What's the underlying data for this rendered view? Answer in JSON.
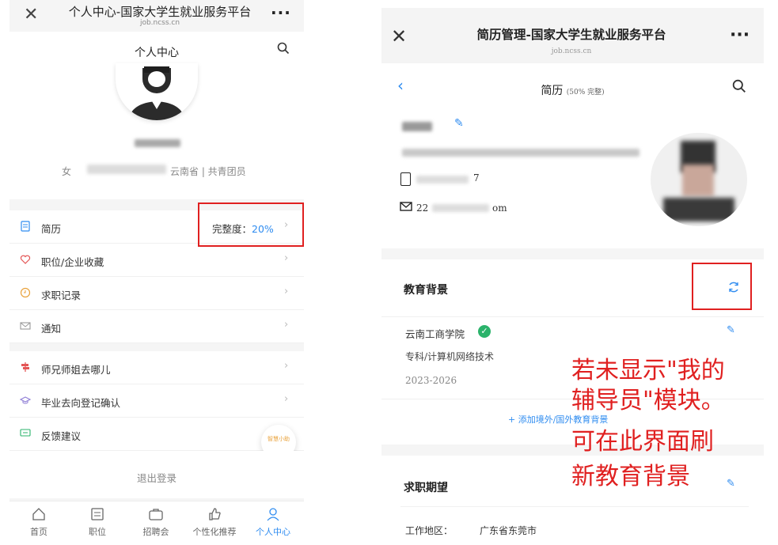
{
  "left": {
    "window": {
      "title": "个人中心-国家大学生就业服务平台",
      "domain": "job.ncss.cn"
    },
    "nav": {
      "title": "个人中心"
    },
    "profile": {
      "gender": "女",
      "region_party": "云南省 | 共青团员"
    },
    "menu_group1": [
      {
        "label": "简历",
        "value_label": "完整度：",
        "value": "20%"
      },
      {
        "label": "职位/企业收藏"
      },
      {
        "label": "求职记录"
      },
      {
        "label": "通知"
      }
    ],
    "menu_group2": [
      {
        "label": "师兄师姐去哪儿"
      },
      {
        "label": "毕业去向登记确认"
      },
      {
        "label": "反馈建议"
      }
    ],
    "assistant": {
      "label": "智慧小助"
    },
    "logout": "退出登录",
    "tabs": [
      {
        "label": "首页"
      },
      {
        "label": "职位"
      },
      {
        "label": "招聘会"
      },
      {
        "label": "个性化推荐"
      },
      {
        "label": "个人中心"
      }
    ]
  },
  "right": {
    "window": {
      "title": "简历管理-国家大学生就业服务平台",
      "domain": "job.ncss.cn"
    },
    "nav": {
      "title": "简历",
      "completeness": "(50% 完整)"
    },
    "contact": {
      "phone_tail": "7",
      "email_prefix": "22",
      "email_tail": "om"
    },
    "education": {
      "heading": "教育背景",
      "school": "云南工商学院",
      "major": "专科/计算机网络技术",
      "years": "2023-2026",
      "add_link": "+ 添加境外/国外教育背景"
    },
    "intent": {
      "heading": "求职期望",
      "location_label": "工作地区：",
      "location": "广东省东莞市"
    }
  },
  "annotation": {
    "lines": [
      "若未显示\"我的",
      "辅导员\"模块。",
      "可在此界面刷",
      "新教育背景"
    ]
  },
  "colors": {
    "accent": "#2f8cf0",
    "highlight": "#e02020",
    "verified": "#2bb36b"
  }
}
